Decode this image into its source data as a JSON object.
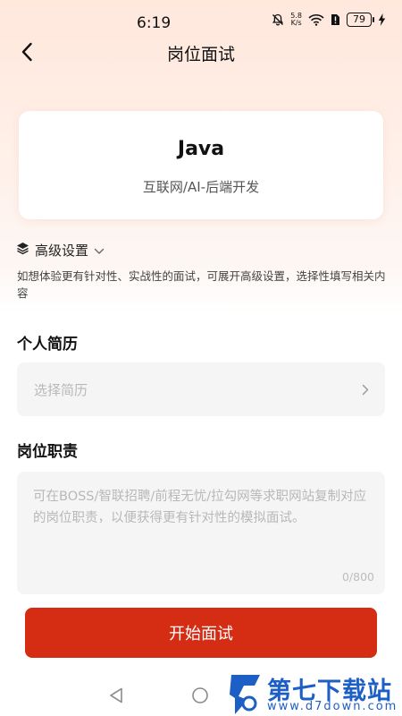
{
  "status_bar": {
    "time": "6:19",
    "net_speed_value": "5.8",
    "net_speed_unit": "K/s",
    "battery": "79"
  },
  "nav": {
    "title": "岗位面试",
    "back_icon": "chevron-left-icon"
  },
  "job": {
    "title": "Java",
    "category": "互联网/AI-后端开发"
  },
  "advanced": {
    "label": "高级设置",
    "icon": "layers-icon",
    "description": "如想体验更有针对性、实战性的面试，可展开高级设置，选择性填写相关内容"
  },
  "resume": {
    "section_title": "个人简历",
    "placeholder": "选择简历"
  },
  "duty": {
    "section_title": "岗位职责",
    "placeholder": "可在BOSS/智联招聘/前程无忧/拉勾网等求职网站复制对应的岗位职责，以便获得更有针对性的模拟面试。",
    "value": "",
    "counter": "0/800"
  },
  "start_button": {
    "label": "开始面试",
    "color": "#d42d14"
  },
  "watermark": {
    "name": "第七下载站",
    "url": "www.d7down.com"
  }
}
